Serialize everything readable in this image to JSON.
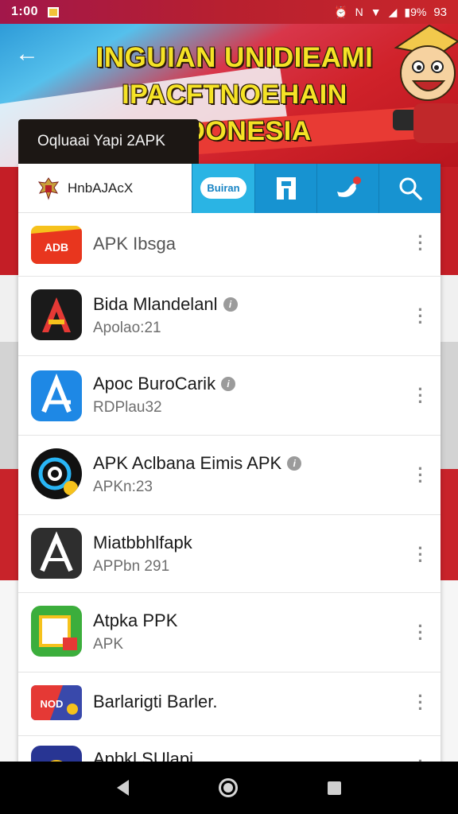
{
  "status_bar": {
    "time": "1:00",
    "icons": [
      "notification-badge-icon",
      "alarm-icon",
      "nfc-icon",
      "wifi-icon",
      "signal-icon",
      "battery-icon"
    ],
    "battery_text": "9%",
    "right_text": "93"
  },
  "banner": {
    "title_line1": "INGUIAN UNIDIEAMI",
    "title_line2": "IPACFTNOEHAIN INDONESIA",
    "back_icon": "arrow-left-icon",
    "colors": {
      "title": "#f5e326",
      "red": "#c41e26",
      "blue": "#2e9bd8"
    }
  },
  "search": {
    "label": "Oqluaai Yapi 2APK"
  },
  "header": {
    "brand_name": "HnbAJAcX",
    "tabs": [
      {
        "name": "tab-bubble",
        "label": "Buiran",
        "icon": "chat-bubble-icon"
      },
      {
        "name": "tab-store",
        "icon": "storefront-icon"
      },
      {
        "name": "tab-twitter",
        "icon": "bird-icon"
      },
      {
        "name": "tab-search",
        "icon": "search-icon"
      }
    ]
  },
  "apps": [
    {
      "name": "APK Ibsga",
      "subtitle": "",
      "icon": "adb-logo-icon",
      "verified": false
    },
    {
      "name": "Bida Mlandelanl",
      "subtitle": "Apolao:21",
      "icon": "red-a-logo-icon",
      "verified": true
    },
    {
      "name": "Apoc BuroCarik",
      "subtitle": "RDPlau32",
      "icon": "blue-a-logo-icon",
      "verified": true
    },
    {
      "name": "APK Aclbana Eimis APK",
      "subtitle": "APKn:23",
      "icon": "at-sign-logo-icon",
      "verified": true
    },
    {
      "name": "Miatbbhlfapk",
      "subtitle": "APPbn 291",
      "icon": "dark-a-logo-icon",
      "verified": false
    },
    {
      "name": "Atpka PPK",
      "subtitle": "APK",
      "icon": "green-box-logo-icon",
      "verified": false
    },
    {
      "name": "Barlarigti Barler.",
      "subtitle": "",
      "icon": "nod-logo-icon",
      "verified": false
    },
    {
      "name": "Apbkl SUlapi",
      "subtitle": "",
      "icon": "badge-logo-icon",
      "verified": false
    }
  ],
  "nav": {
    "back": "back-icon",
    "home": "home-icon",
    "recents": "recents-icon"
  }
}
